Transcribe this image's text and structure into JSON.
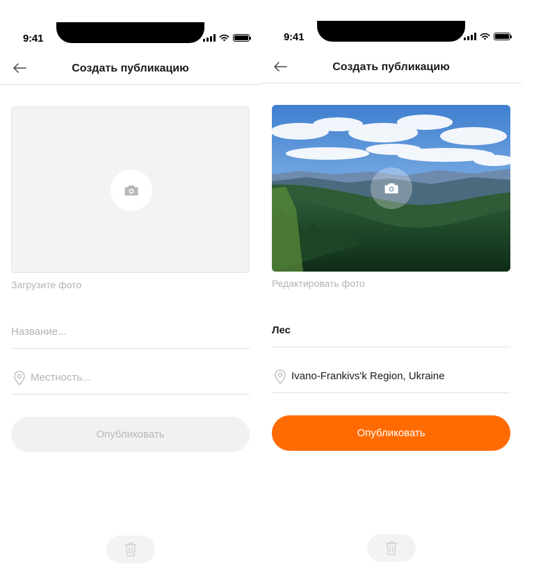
{
  "colors": {
    "accent": "#ff6b00",
    "placeholder": "#b3b3b3",
    "divider": "#e0e0e0",
    "disabled_bg": "#f1f1f1"
  },
  "screens": [
    {
      "state": "empty",
      "status_time": "9:41",
      "header": {
        "back_icon": "arrow-left-icon",
        "title": "Создать публикацию"
      },
      "photo": {
        "icon": "camera-icon",
        "caption": "Загрузите фото"
      },
      "title_field": {
        "placeholder": "Название...",
        "value": ""
      },
      "location_field": {
        "icon": "location-pin-icon",
        "placeholder": "Местность...",
        "value": ""
      },
      "publish_button": {
        "label": "Опубликовать",
        "enabled": false
      },
      "delete_icon": "trash-icon"
    },
    {
      "state": "filled",
      "status_time": "9:41",
      "header": {
        "back_icon": "arrow-left-icon",
        "title": "Создать публикацию"
      },
      "photo": {
        "icon": "camera-icon",
        "caption": "Редактировать фото"
      },
      "title_field": {
        "placeholder": "Название...",
        "value": "Лес"
      },
      "location_field": {
        "icon": "location-pin-icon",
        "placeholder": "Местность...",
        "value": "Ivano-Frankivs'k Region, Ukraine"
      },
      "publish_button": {
        "label": "Опубликовать",
        "enabled": true
      },
      "delete_icon": "trash-icon"
    }
  ]
}
